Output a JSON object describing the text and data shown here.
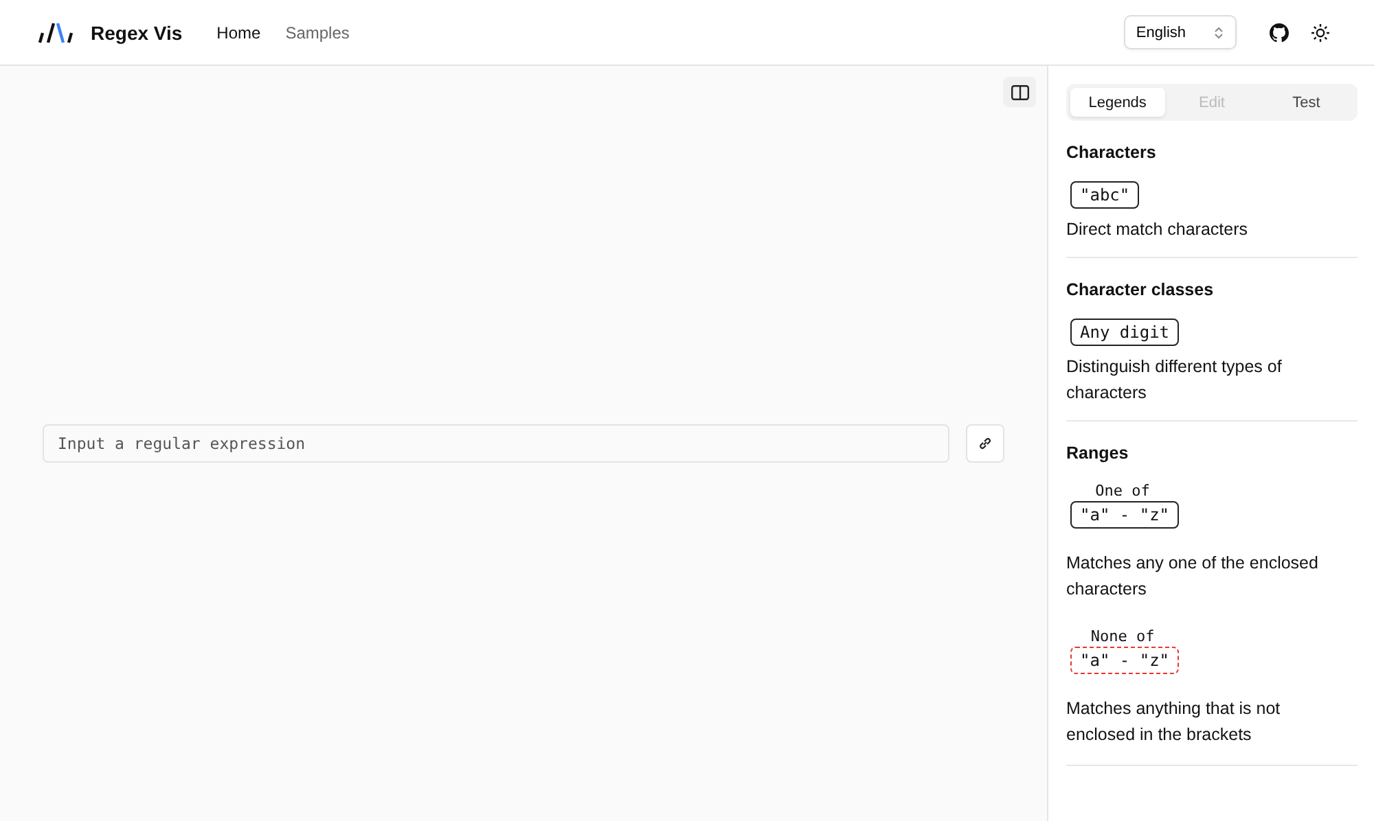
{
  "header": {
    "brand": "Regex Vis",
    "nav": [
      {
        "label": "Home",
        "selected": true
      },
      {
        "label": "Samples",
        "selected": false
      }
    ],
    "language": "English"
  },
  "editor": {
    "placeholder": "Input a regular expression"
  },
  "panel": {
    "tabs": [
      {
        "label": "Legends",
        "selected": true,
        "disabled": false
      },
      {
        "label": "Edit",
        "selected": false,
        "disabled": true
      },
      {
        "label": "Test",
        "selected": false,
        "disabled": false
      }
    ],
    "sections": [
      {
        "title": "Characters",
        "items": [
          {
            "kind": "node",
            "node_text": "\"abc\"",
            "description": "Direct match characters"
          }
        ]
      },
      {
        "title": "Character classes",
        "items": [
          {
            "kind": "node",
            "node_text": "Any digit",
            "description": "Distinguish different types of characters"
          }
        ]
      },
      {
        "title": "Ranges",
        "items": [
          {
            "kind": "range",
            "label": "One of",
            "negated": false,
            "node_text": "\"a\" - \"z\"",
            "description": "Matches any one of the enclosed characters"
          },
          {
            "kind": "range",
            "label": "None of",
            "negated": true,
            "node_text": "\"a\" - \"z\"",
            "description": "Matches anything that is not enclosed in the brackets"
          }
        ]
      }
    ]
  }
}
